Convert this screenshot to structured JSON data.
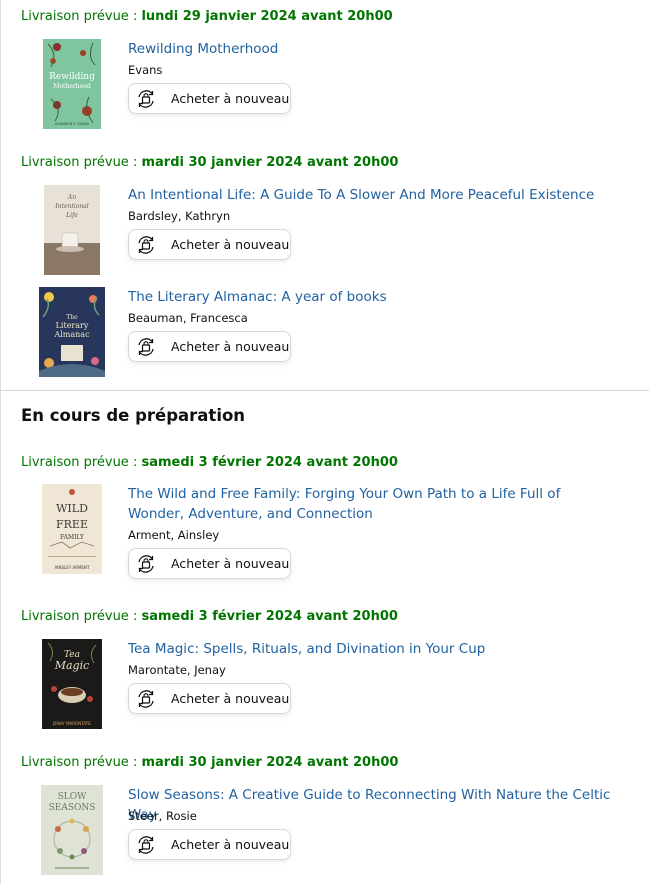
{
  "colors": {
    "delivery_green": "#007600",
    "link_blue": "#2162a1"
  },
  "section_in_progress_title": "En cours de préparation",
  "buy_again_label": "Acheter à nouveau",
  "buy_again_icon": "reorder-cycle-icon",
  "deliveries": [
    {
      "prefix": "Livraison prévue :",
      "date": "lundi 29 janvier 2024 avant 20h00"
    },
    {
      "prefix": "Livraison prévue :",
      "date": "mardi 30 janvier 2024 avant 20h00"
    },
    {
      "prefix": "Livraison prévue :",
      "date": "samedi 3 février 2024 avant 20h00"
    },
    {
      "prefix": "Livraison prévue :",
      "date": "samedi 3 février 2024 avant 20h00"
    },
    {
      "prefix": "Livraison prévue :",
      "date": "mardi 30 janvier 2024 avant 20h00"
    }
  ],
  "items": [
    {
      "title": "Rewilding Motherhood",
      "author": "Evans",
      "cover": {
        "text": [
          "Rewilding",
          "Motherhood"
        ],
        "footer": "SHANNON K. EVANS"
      }
    },
    {
      "title": "An Intentional Life: A Guide To A Slower And More Peaceful Existence",
      "author": "Bardsley, Kathryn",
      "cover": {
        "text": [
          "An",
          "Intentional",
          "Life"
        ]
      }
    },
    {
      "title": "The Literary Almanac: A year of books",
      "author": "Beauman, Francesca",
      "cover": {
        "text": [
          "The",
          "Literary",
          "Almanac"
        ]
      }
    },
    {
      "title": "The Wild and Free Family: Forging Your Own Path to a Life Full of Wonder, Adventure, and Connection",
      "author": "Arment, Ainsley",
      "cover": {
        "text": [
          "WILD",
          "FREE",
          "FAMILY"
        ],
        "footer": "AINSLEY ARMENT"
      }
    },
    {
      "title": "Tea Magic: Spells, Rituals, and Divination in Your Cup",
      "author": "Marontate, Jenay",
      "cover": {
        "text": [
          "Tea",
          "Magic"
        ],
        "footer": "JENAY MARONTATE"
      }
    },
    {
      "title": "Slow Seasons: A Creative Guide to Reconnecting With Nature the Celtic Way",
      "author": "Steer, Rosie",
      "cover": {
        "text": [
          "SLOW",
          "SEASONS"
        ]
      }
    }
  ]
}
